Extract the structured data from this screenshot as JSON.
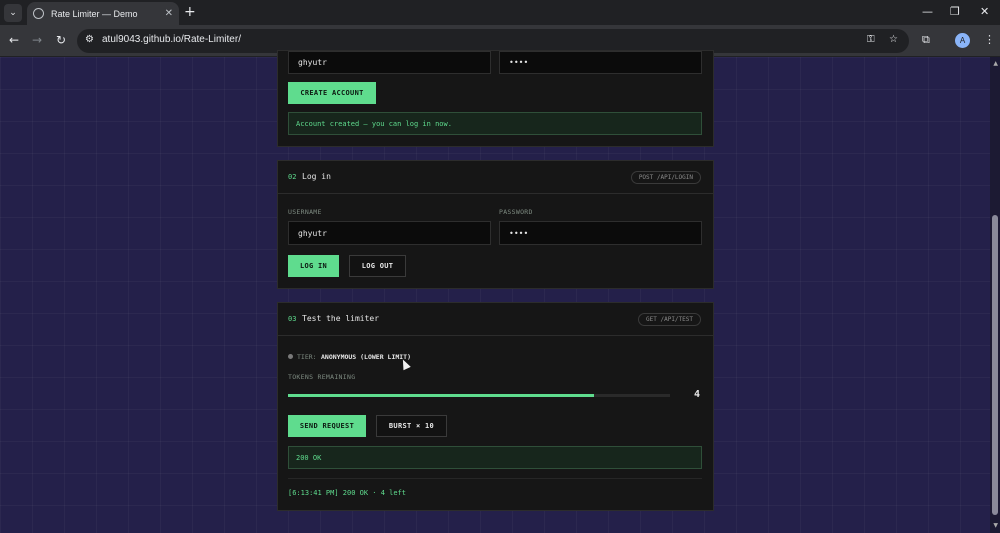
{
  "browser": {
    "tab_title": "Rate Limiter — Demo",
    "tab_close": "✕",
    "tab_search": "⌄",
    "new_tab": "+",
    "win_min": "—",
    "win_restore": "❐",
    "win_close": "✕",
    "back": "←",
    "forward": "→",
    "reload": "↻",
    "url": "atul9043.github.io/Rate-Limiter/",
    "omni_tune": "⚙",
    "password_key": "⚿",
    "bookmark_star": "☆",
    "extensions": "⧉",
    "profile_initial": "A",
    "menu": "⋮",
    "scroll_up": "▲",
    "scroll_down": "▼"
  },
  "signup": {
    "username_value": "ghyutr",
    "password_value": "••••",
    "create_button": "CREATE ACCOUNT",
    "message": "Account created — you can log in now."
  },
  "login": {
    "number": "02",
    "title": "Log in",
    "endpoint": "POST /API/LOGIN",
    "username_label": "USERNAME",
    "password_label": "PASSWORD",
    "username_value": "ghyutr",
    "password_value": "••••",
    "login_button": "LOG IN",
    "logout_button": "LOG OUT"
  },
  "limiter": {
    "number": "03",
    "title": "Test the limiter",
    "endpoint": "GET /API/TEST",
    "tier_label": "TIER:",
    "tier_value": "ANONYMOUS (LOWER LIMIT)",
    "tokens_label": "TOKENS REMAINING",
    "tokens_remaining": "4",
    "tokens_fraction": 0.8,
    "send_button": "SEND REQUEST",
    "burst_button": "BURST × 10",
    "status": "200 OK",
    "log": [
      "[6:13:41 PM] 200 OK · 4 left"
    ]
  },
  "colors": {
    "accent": "#5fdc8e",
    "page_background": "#24204a",
    "card_background": "#161616"
  }
}
